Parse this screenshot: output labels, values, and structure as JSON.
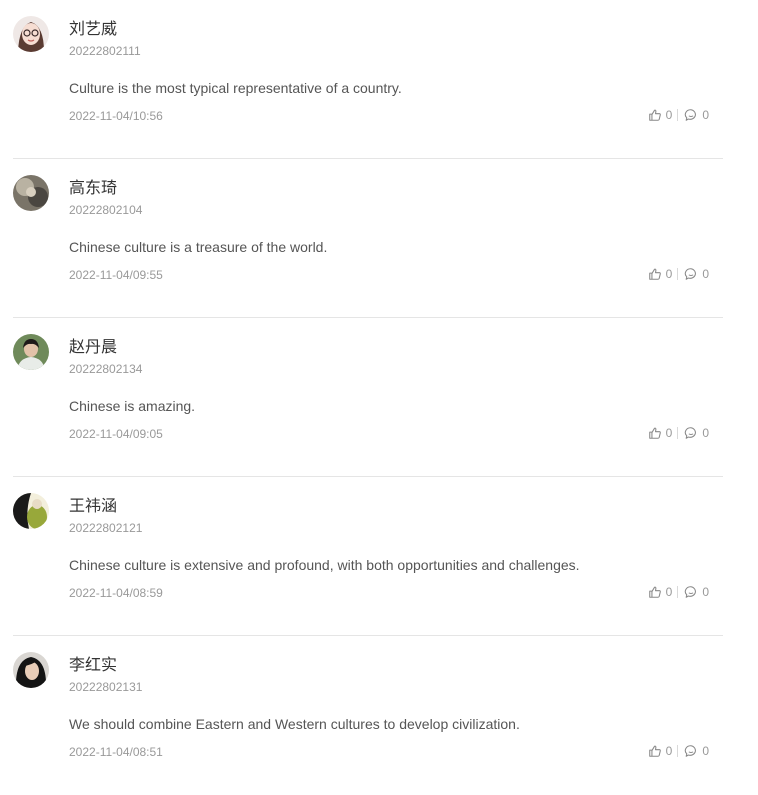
{
  "comments": [
    {
      "name": "刘艺威",
      "student_id": "20222802111",
      "text": "Culture is the most typical representative of a country.",
      "time": "2022-11-04/10:56",
      "likes": "0",
      "replies": "0"
    },
    {
      "name": "高东琦",
      "student_id": "20222802104",
      "text": "Chinese culture is a treasure of the world.",
      "time": "2022-11-04/09:55",
      "likes": "0",
      "replies": "0"
    },
    {
      "name": "赵丹晨",
      "student_id": "20222802134",
      "text": "Chinese is amazing.",
      "time": "2022-11-04/09:05",
      "likes": "0",
      "replies": "0"
    },
    {
      "name": "王祎涵",
      "student_id": "20222802121",
      "text": "Chinese culture is extensive and profound, with both opportunities and challenges.",
      "time": "2022-11-04/08:59",
      "likes": "0",
      "replies": "0"
    },
    {
      "name": "李红实",
      "student_id": "20222802131",
      "text": "We should combine Eastern and Western cultures to develop civilization.",
      "time": "2022-11-04/08:51",
      "likes": "0",
      "replies": "0"
    }
  ],
  "icons": {
    "like": "thumbs-up-icon",
    "reply": "comment-bubble-icon"
  },
  "colors": {
    "name": "#333333",
    "meta": "#999999",
    "text": "#555555",
    "divider": "#e5e5e5"
  }
}
